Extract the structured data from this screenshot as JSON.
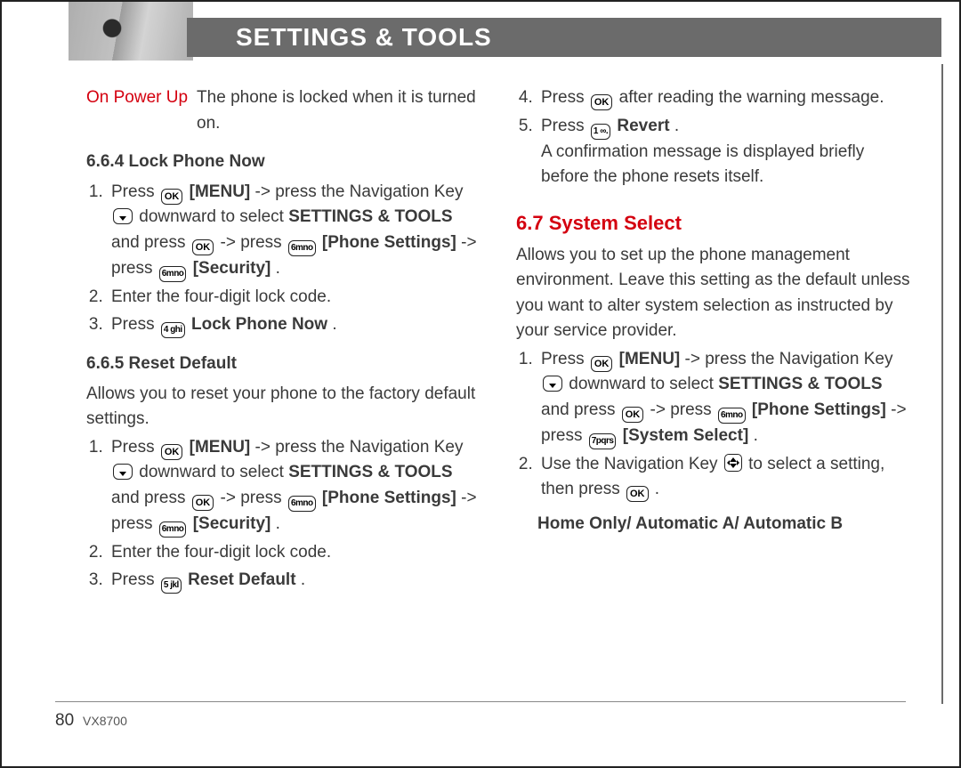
{
  "header": {
    "title": "SETTINGS & TOOLS"
  },
  "left": {
    "powerUp": {
      "label": "On Power Up",
      "desc": "The phone is locked when it is turned on."
    },
    "s664": {
      "title": "6.6.4 Lock Phone Now",
      "step1a": "Press ",
      "step1b": " [MENU]",
      "step1c": " -> press the Navigation Key ",
      "step1d": " downward to select ",
      "step1e": "SETTINGS & TOOLS",
      "step1f": " and press ",
      "step1g": " -> press ",
      "step1h": " [Phone Settings]",
      "step1i": " -> press ",
      "step1j": " [Security]",
      "step1k": ".",
      "step2": "Enter the four-digit lock code.",
      "step3a": "Press ",
      "step3b": " Lock Phone Now",
      "step3c": "."
    },
    "s665": {
      "title": "6.6.5 Reset Default",
      "intro": "Allows you to reset your phone to the factory default settings.",
      "step1a": "Press ",
      "step1b": " [MENU]",
      "step1c": " -> press the Navigation Key ",
      "step1d": " downward to select ",
      "step1e": "SETTINGS & TOOLS",
      "step1f": " and press ",
      "step1g": " -> press ",
      "step1h": " [Phone Settings]",
      "step1i": " -> press ",
      "step1j": " [Security]",
      "step1k": ".",
      "step2": "Enter the four-digit lock code.",
      "step3a": "Press ",
      "step3b": " Reset Default",
      "step3c": "."
    }
  },
  "right": {
    "step4a": "Press ",
    "step4b": " after reading the warning message.",
    "step5a": "Press ",
    "step5b": " Revert",
    "step5c": ".",
    "step5desc": "A confirmation message is displayed briefly before the phone resets itself.",
    "s67": {
      "title": "6.7 System Select",
      "intro": "Allows you to set up the phone management environment. Leave this setting as the default unless you want to alter system selection as instructed by your service provider.",
      "step1a": "Press ",
      "step1b": " [MENU]",
      "step1c": " -> press the Navigation Key ",
      "step1d": " downward to select ",
      "step1e": "SETTINGS & TOOLS",
      "step1f": " and press ",
      "step1g": " -> press ",
      "step1h": " [Phone Settings]",
      "step1i": " -> press ",
      "step1j": " [System Select]",
      "step1k": ".",
      "step2a": "Use the Navigation Key ",
      "step2b": " to select a setting, then press ",
      "step2c": ".",
      "options": "Home Only/ Automatic A/ Automatic B"
    }
  },
  "keys": {
    "ok": "OK",
    "k1": "1 ∞.",
    "k4": "4 ghi",
    "k5": "5 jkl",
    "k6": "6mno",
    "k7": "7pqrs"
  },
  "footer": {
    "page": "80",
    "model": "VX8700"
  }
}
